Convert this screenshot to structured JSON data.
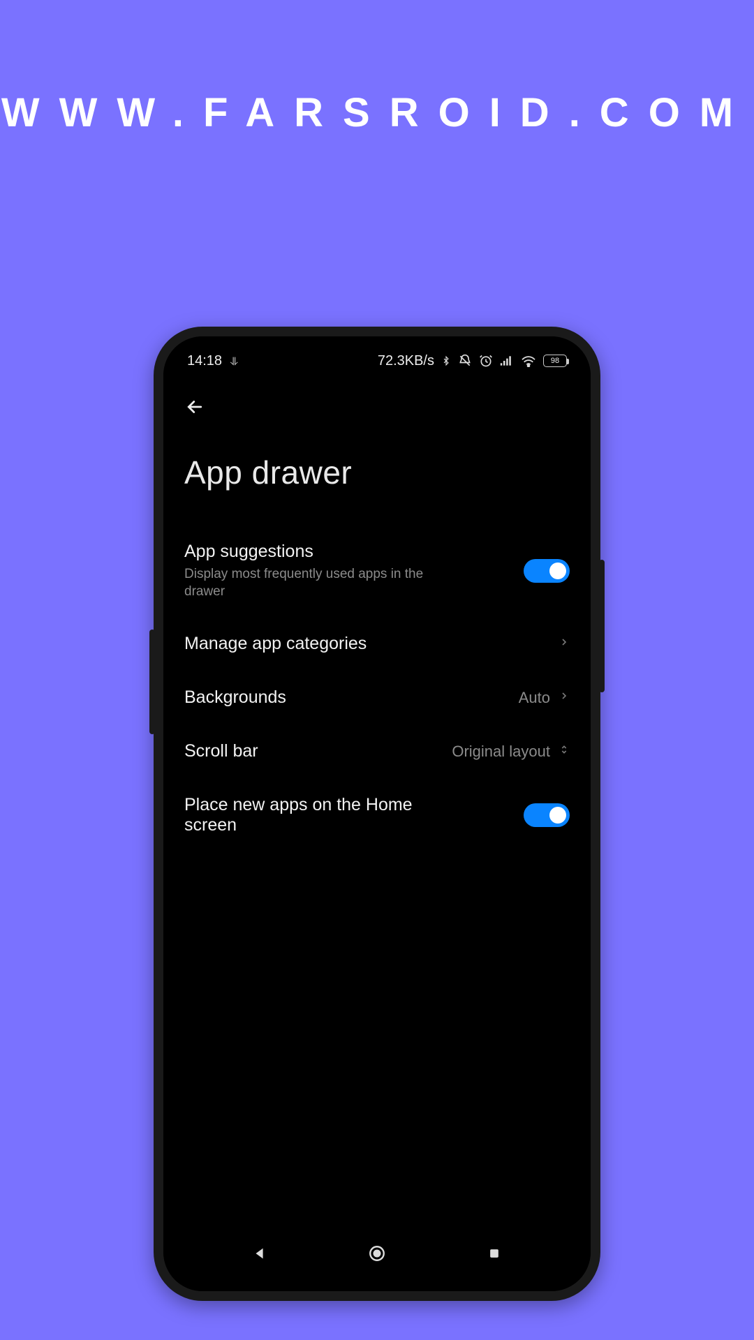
{
  "watermark": "WWW.FARSROID.COM",
  "status": {
    "time": "14:18",
    "net_speed": "72.3KB/s",
    "battery": "98"
  },
  "page": {
    "title": "App drawer"
  },
  "settings": {
    "app_suggestions": {
      "title": "App suggestions",
      "sub": "Display most fre­quently used apps in the drawer"
    },
    "manage_categories": {
      "title": "Manage app categories"
    },
    "backgrounds": {
      "title": "Backgrounds",
      "value": "Auto"
    },
    "scrollbar": {
      "title": "Scroll bar",
      "value": "Original layout"
    },
    "place_new": {
      "title": "Place new apps on the Home screen"
    }
  }
}
